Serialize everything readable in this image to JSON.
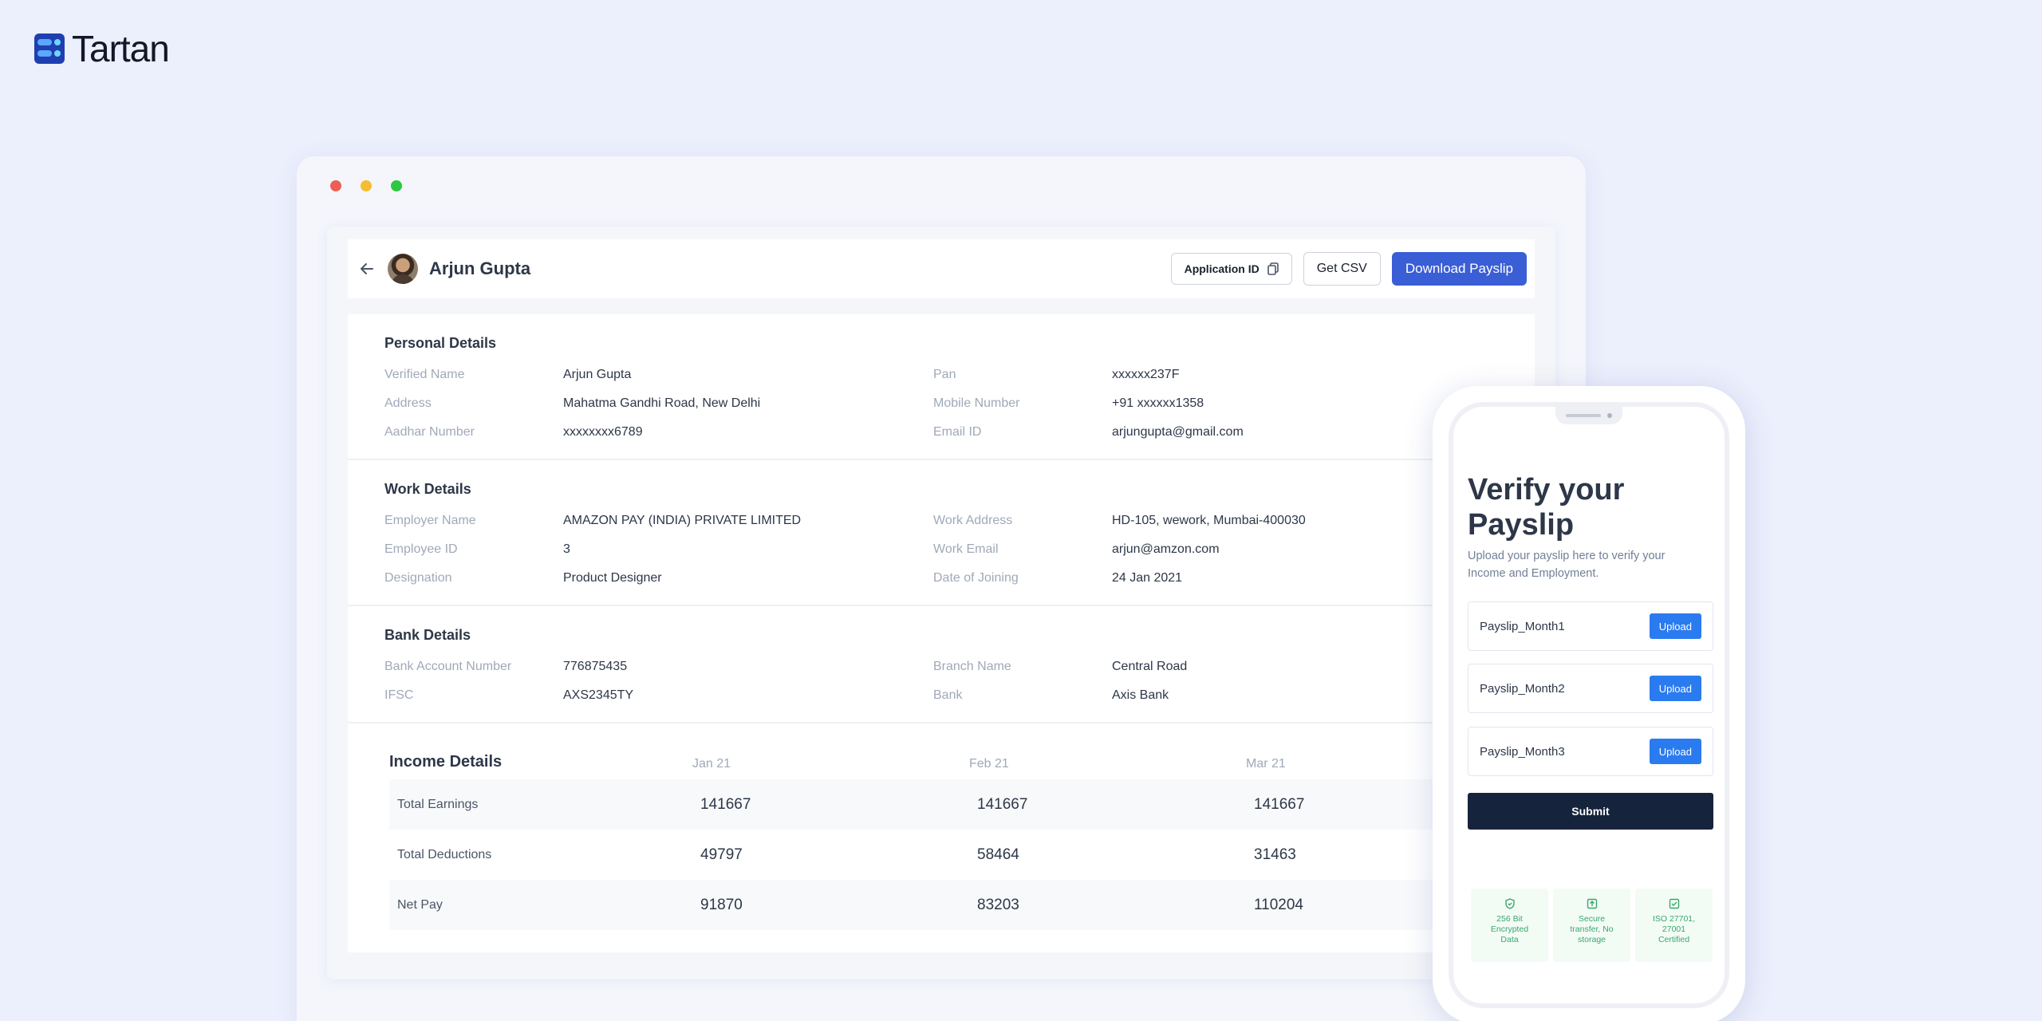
{
  "brand": {
    "name": "Tartan"
  },
  "window": {
    "traffic_colors": [
      "#ec5f57",
      "#f5bd2f",
      "#2bc840"
    ]
  },
  "header": {
    "person_name": "Arjun Gupta",
    "application_id_label": "Application ID",
    "csv_label": "Get CSV",
    "download_label": "Download Payslip"
  },
  "personal": {
    "title": "Personal Details",
    "rows": [
      {
        "l1": "Verified Name",
        "v1": "Arjun Gupta",
        "l2": "Pan",
        "v2": "xxxxxx237F"
      },
      {
        "l1": "Address",
        "v1": "Mahatma Gandhi Road, New Delhi",
        "l2": "Mobile Number",
        "v2": "+91 xxxxxx1358"
      },
      {
        "l1": "Aadhar Number",
        "v1": "xxxxxxxx6789",
        "l2": "Email ID",
        "v2": "arjungupta@gmail.com"
      }
    ]
  },
  "work": {
    "title": "Work Details",
    "rows": [
      {
        "l1": "Employer Name",
        "v1": "AMAZON PAY (INDIA) PRIVATE LIMITED",
        "l2": "Work Address",
        "v2": "HD-105, wework, Mumbai-400030"
      },
      {
        "l1": "Employee ID",
        "v1": "3",
        "l2": "Work Email",
        "v2": "arjun@amzon.com"
      },
      {
        "l1": "Designation",
        "v1": "Product Designer",
        "l2": "Date of Joining",
        "v2": "24 Jan 2021"
      }
    ]
  },
  "bank": {
    "title": "Bank Details",
    "rows": [
      {
        "l1": "Bank Account Number",
        "v1": "776875435",
        "l2": "Branch Name",
        "v2": "Central Road"
      },
      {
        "l1": "IFSC",
        "v1": "AXS2345TY",
        "l2": "Bank",
        "v2": "Axis Bank"
      }
    ]
  },
  "income": {
    "title": "Income Details",
    "months": [
      "Jan 21",
      "Feb 21",
      "Mar 21"
    ],
    "rows": [
      {
        "label": "Total Earnings",
        "values": [
          "141667",
          "141667",
          "141667"
        ]
      },
      {
        "label": "Total Deductions",
        "values": [
          "49797",
          "58464",
          "31463"
        ]
      },
      {
        "label": "Net Pay",
        "values": [
          "91870",
          "83203",
          "110204"
        ]
      }
    ]
  },
  "phone": {
    "title": "Verify your Payslip",
    "subtitle": "Upload your payslip here to verify your Income and Employment.",
    "slots": [
      {
        "name": "Payslip_Month1",
        "button": "Upload"
      },
      {
        "name": "Payslip_Month2",
        "button": "Upload"
      },
      {
        "name": "Payslip_Month3",
        "button": "Upload"
      }
    ],
    "submit_label": "Submit",
    "badges": [
      {
        "icon": "shield-icon",
        "text": "256 Bit Encrypted Data"
      },
      {
        "icon": "upload-icon",
        "text": "Secure transfer, No storage"
      },
      {
        "icon": "certificate-icon",
        "text": "ISO 27701, 27001 Certified"
      }
    ]
  }
}
